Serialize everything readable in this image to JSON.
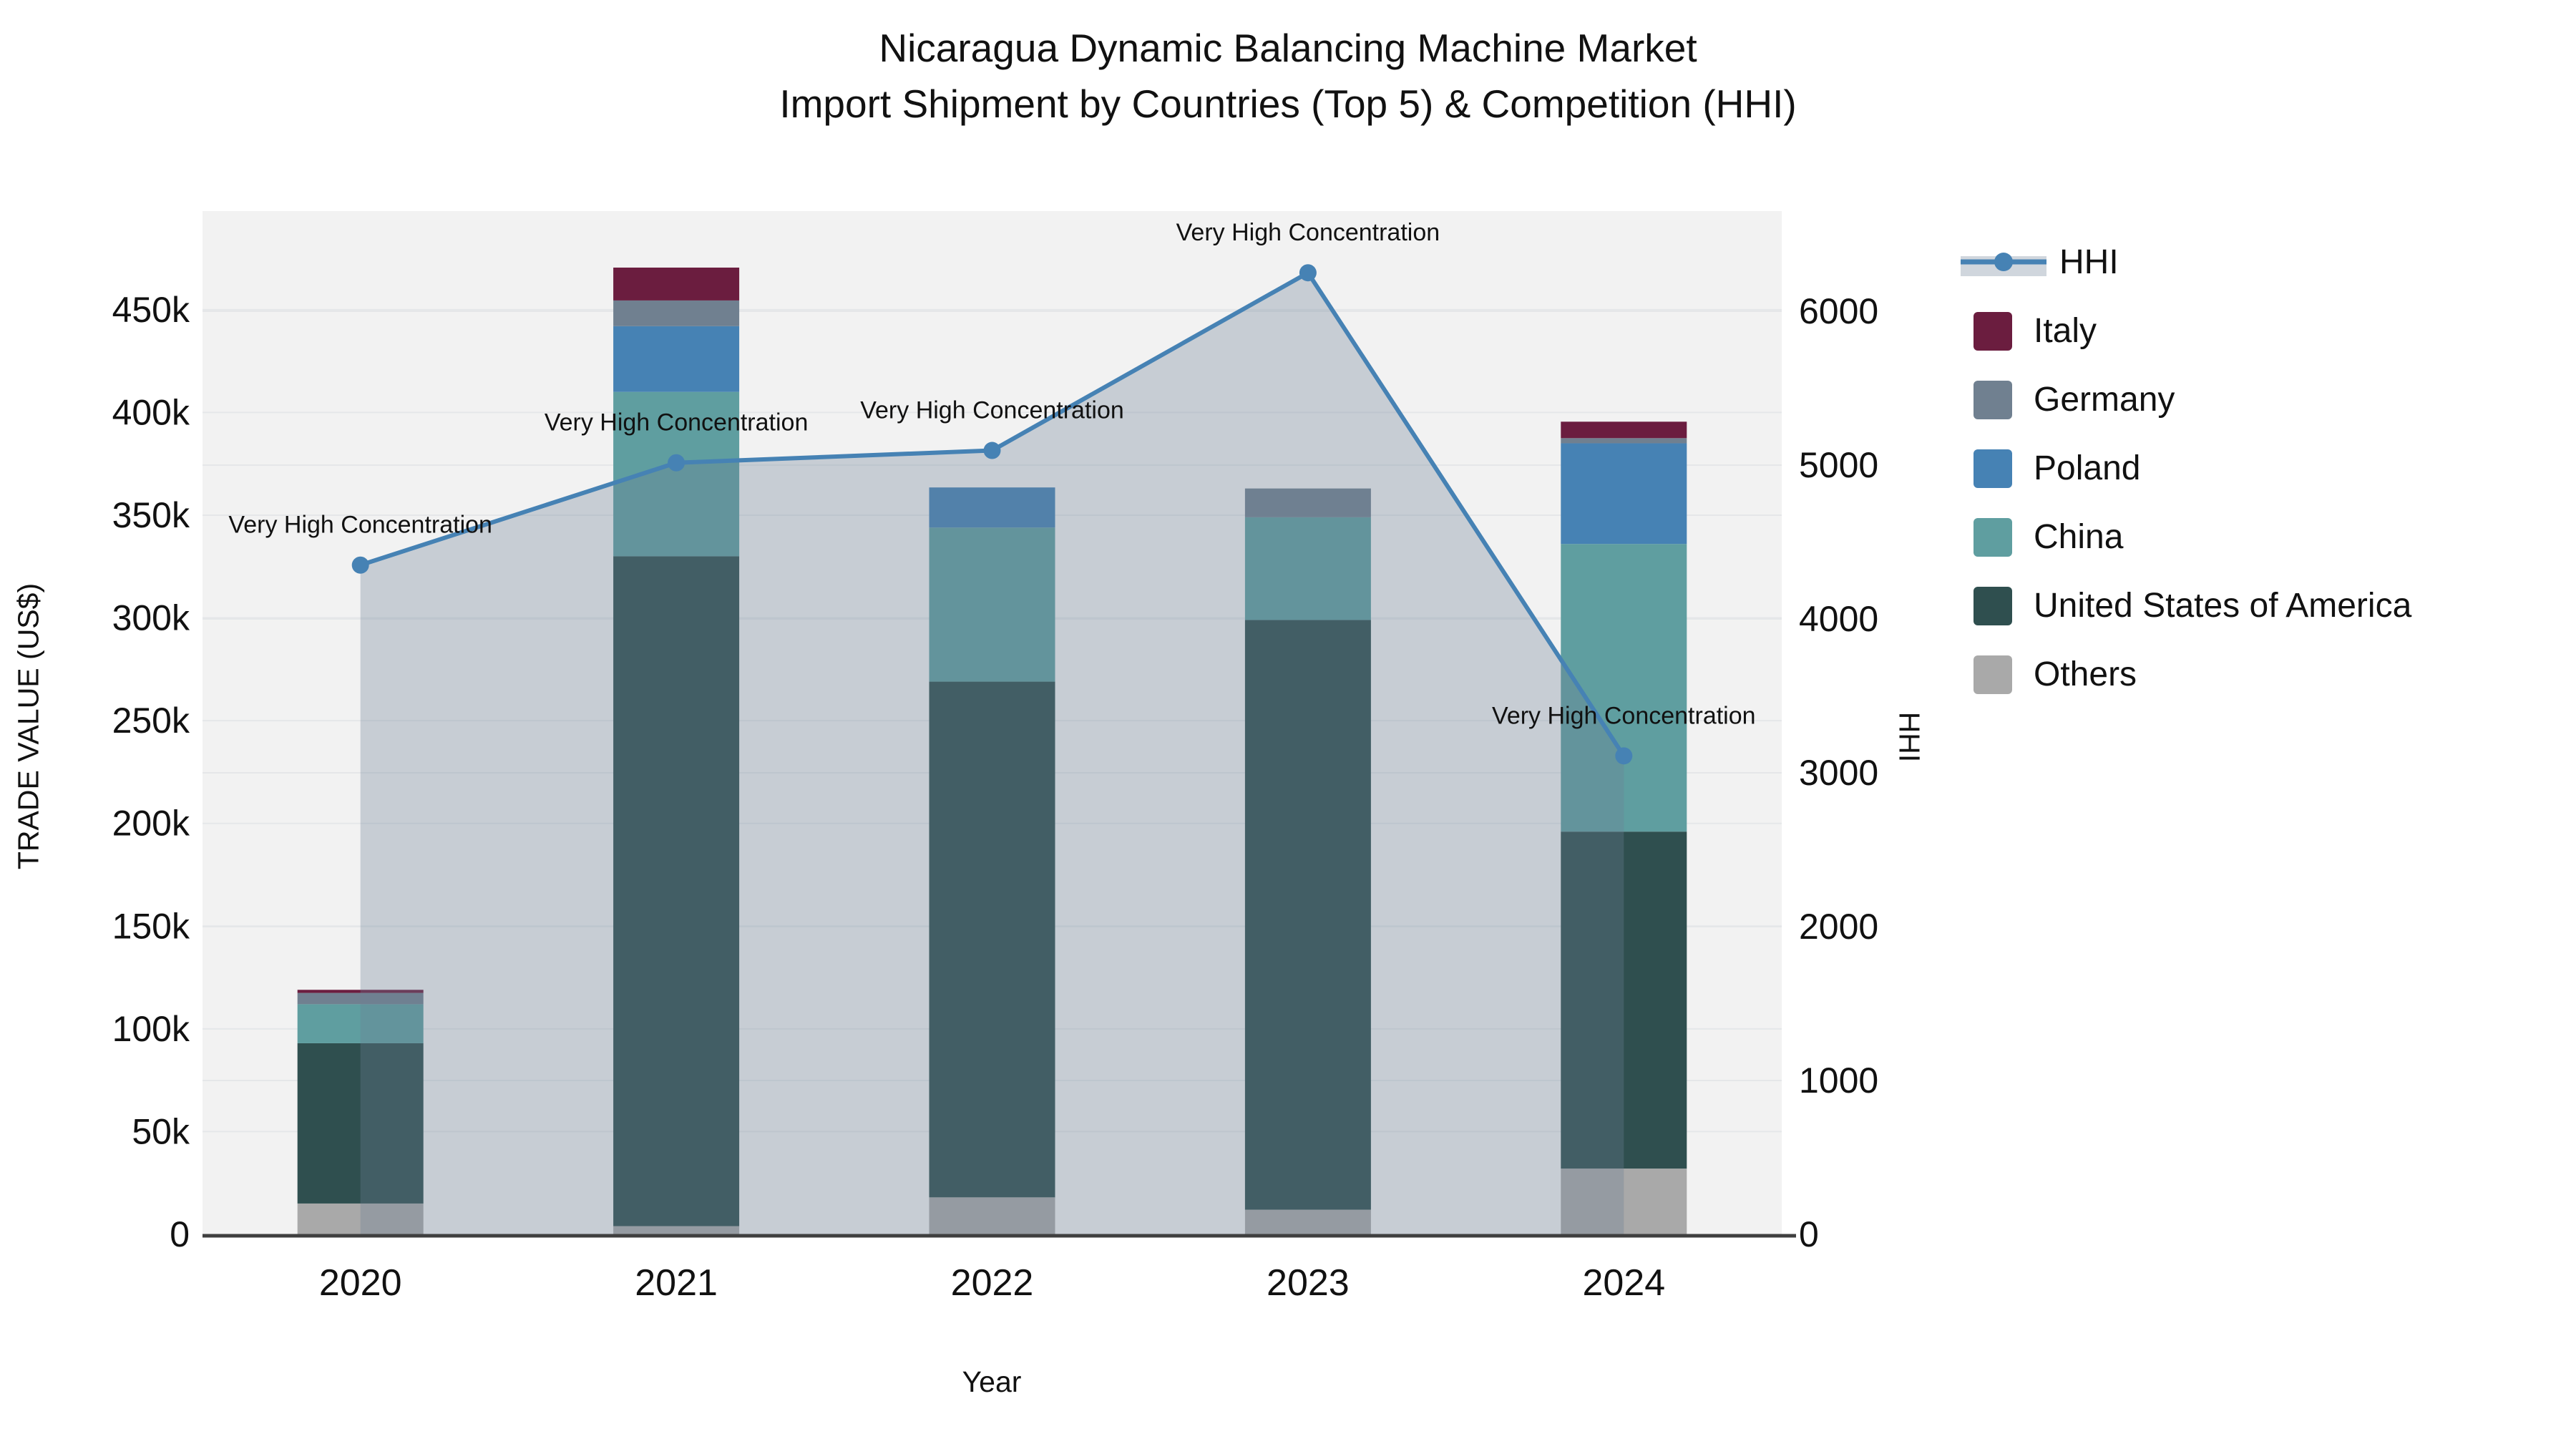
{
  "title": {
    "line1": "Nicaragua Dynamic Balancing Machine Market",
    "line2": "Import Shipment by Countries (Top 5) & Competition (HHI)"
  },
  "axes": {
    "x": {
      "title": "Year"
    },
    "y_left": {
      "title": "TRADE VALUE (US$)",
      "max": 498000,
      "ticks": [
        {
          "v": 0,
          "label": "0"
        },
        {
          "v": 50000,
          "label": "50k"
        },
        {
          "v": 100000,
          "label": "100k"
        },
        {
          "v": 150000,
          "label": "150k"
        },
        {
          "v": 200000,
          "label": "200k"
        },
        {
          "v": 250000,
          "label": "250k"
        },
        {
          "v": 300000,
          "label": "300k"
        },
        {
          "v": 350000,
          "label": "350k"
        },
        {
          "v": 400000,
          "label": "400k"
        },
        {
          "v": 450000,
          "label": "450k"
        }
      ]
    },
    "y_right": {
      "title": "HHI",
      "max": 6651,
      "ticks": [
        {
          "v": 0,
          "label": "0"
        },
        {
          "v": 1000,
          "label": "1000"
        },
        {
          "v": 2000,
          "label": "2000"
        },
        {
          "v": 3000,
          "label": "3000"
        },
        {
          "v": 4000,
          "label": "4000"
        },
        {
          "v": 5000,
          "label": "5000"
        },
        {
          "v": 6000,
          "label": "6000"
        }
      ]
    }
  },
  "chart_data": {
    "type": [
      "bar",
      "line"
    ],
    "note": "Stacked import trade value bars (left axis, US$) with HHI competition line (right axis)",
    "categories": [
      "2020",
      "2021",
      "2022",
      "2023",
      "2024"
    ],
    "series": [
      {
        "name": "Others",
        "color": "#A9A9A9",
        "values": [
          15000,
          4000,
          18000,
          12000,
          32000
        ]
      },
      {
        "name": "United States of America",
        "color": "#2F4F4F",
        "values": [
          78000,
          326000,
          251000,
          287000,
          164000
        ]
      },
      {
        "name": "China",
        "color": "#5F9EA0",
        "values": [
          19000,
          80000,
          75000,
          50000,
          140000
        ]
      },
      {
        "name": "Poland",
        "color": "#4682B4",
        "values": [
          0,
          32000,
          19500,
          0,
          49000
        ]
      },
      {
        "name": "Germany",
        "color": "#708090",
        "values": [
          5500,
          12500,
          0,
          14000,
          2500
        ]
      },
      {
        "name": "Italy",
        "color": "#6B1D3F",
        "values": [
          1500,
          16000,
          0,
          0,
          8000
        ]
      }
    ],
    "bar_totals": [
      119000,
      470500,
      363500,
      363000,
      395500
    ],
    "hhi": {
      "name": "HHI",
      "color": "#4682B4",
      "values": [
        4350,
        5015,
        5095,
        6250,
        3110
      ],
      "annotations": [
        "Very High Concentration",
        "Very High Concentration",
        "Very High Concentration",
        "Very High Concentration",
        "Very High Concentration"
      ]
    }
  },
  "legend": {
    "items": [
      {
        "label": "HHI",
        "type": "line",
        "color": "#4682B4"
      },
      {
        "label": "Italy",
        "type": "chip",
        "color": "#6B1D3F"
      },
      {
        "label": "Germany",
        "type": "chip",
        "color": "#708090"
      },
      {
        "label": "Poland",
        "type": "chip",
        "color": "#4682B4"
      },
      {
        "label": "China",
        "type": "chip",
        "color": "#5F9EA0"
      },
      {
        "label": "United States of America",
        "type": "chip",
        "color": "#2F4F4F"
      },
      {
        "label": "Others",
        "type": "chip",
        "color": "#A9A9A9"
      }
    ]
  },
  "colors": {
    "plot_bg": "#F2F2F2",
    "grid": "#E5E7E9",
    "axis_line": "#3F3F3F",
    "area_fill": "rgba(108,126,148,0.32)",
    "text": "#111111"
  }
}
